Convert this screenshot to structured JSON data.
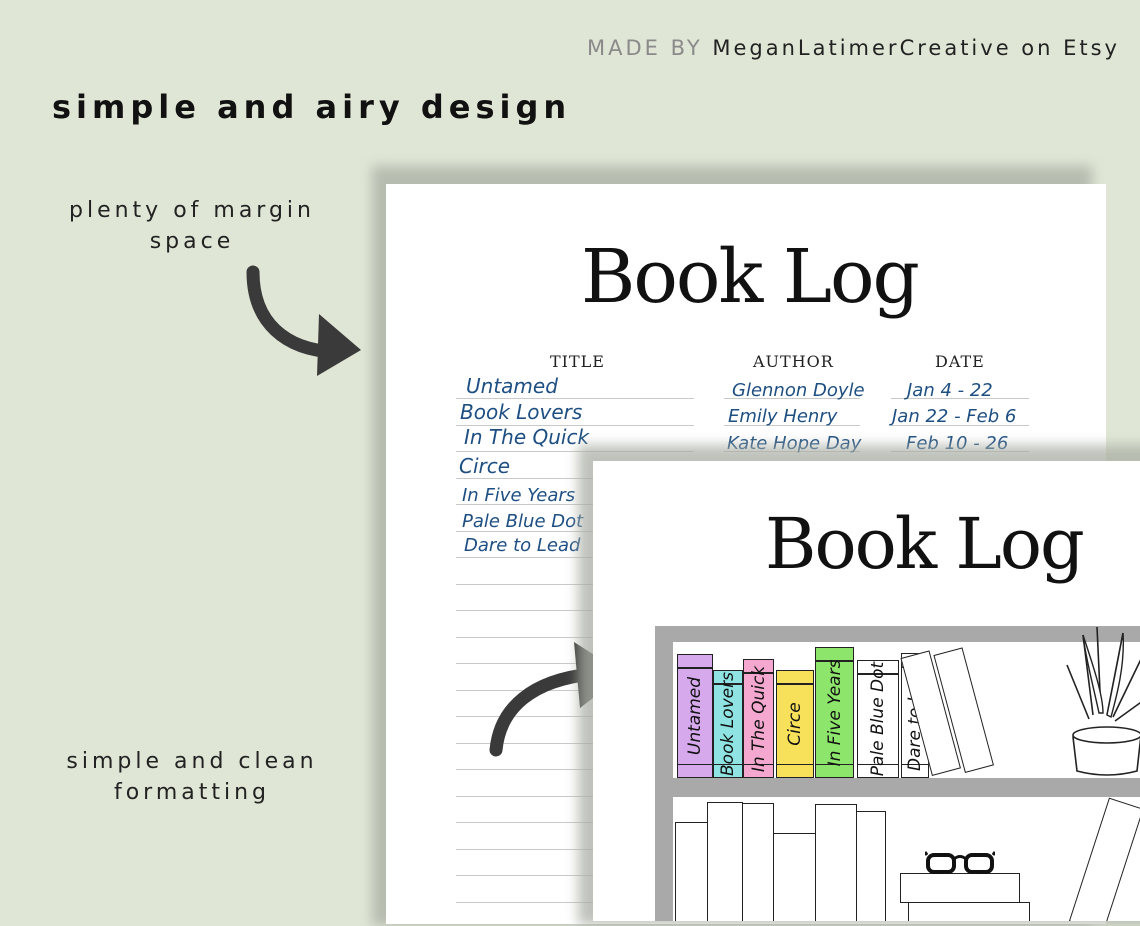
{
  "credit": {
    "made_by": "MADE BY",
    "shop": "MeganLatimerCreative on Etsy"
  },
  "headline": "simple and airy design",
  "callouts": {
    "margin": [
      "plenty of margin",
      "space"
    ],
    "format": [
      "simple and clean",
      "formatting"
    ]
  },
  "back_page": {
    "title": "Book Log",
    "columns": [
      "TITLE",
      "AUTHOR",
      "DATE"
    ],
    "titles": [
      "Untamed",
      "Book Lovers",
      "In The Quick",
      "Circe",
      "In Five Years",
      "Pale Blue Dot",
      "Dare to Lead"
    ],
    "authors": [
      "Glennon Doyle",
      "Emily Henry",
      "Kate Hope Day"
    ],
    "dates": [
      "Jan 4 - 22",
      "Jan 22 - Feb 6",
      "Feb 10 - 26"
    ]
  },
  "front_page": {
    "title": "Book Log",
    "spines": [
      {
        "label": "Untamed",
        "color": "#d6a8ec"
      },
      {
        "label": "Book Lovers",
        "color": "#8fe3e3"
      },
      {
        "label": "In The Quick",
        "color": "#f5a8cf"
      },
      {
        "label": "Circe",
        "color": "#f7e05a"
      },
      {
        "label": "In Five Years",
        "color": "#8ee56b"
      },
      {
        "label": "Pale Blue Dot",
        "color": "#ffffff"
      },
      {
        "label": "Dare to Lead",
        "color": "#ffffff"
      }
    ]
  },
  "icons": {
    "arrow_1": "curved-arrow-icon",
    "arrow_2": "curved-arrow-icon",
    "glasses": "glasses-icon",
    "plant": "potted-plant-icon"
  }
}
